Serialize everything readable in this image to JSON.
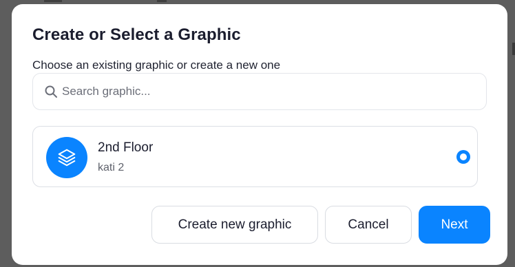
{
  "dialog": {
    "title": "Create or Select a Graphic",
    "subtitle": "Choose an existing graphic or create a new one"
  },
  "search": {
    "placeholder": "Search graphic...",
    "value": "",
    "icon": "search-icon"
  },
  "graphics": [
    {
      "name": "2nd Floor",
      "subtitle": "kati 2",
      "icon": "layers-icon",
      "selected": true
    }
  ],
  "actions": {
    "create_label": "Create new graphic",
    "cancel_label": "Cancel",
    "next_label": "Next"
  },
  "colors": {
    "accent": "#0a84ff",
    "title_text": "#1b1d2e",
    "muted_text": "#5e616b",
    "border": "#dcdfe5",
    "backdrop": "#5d5d5d"
  }
}
